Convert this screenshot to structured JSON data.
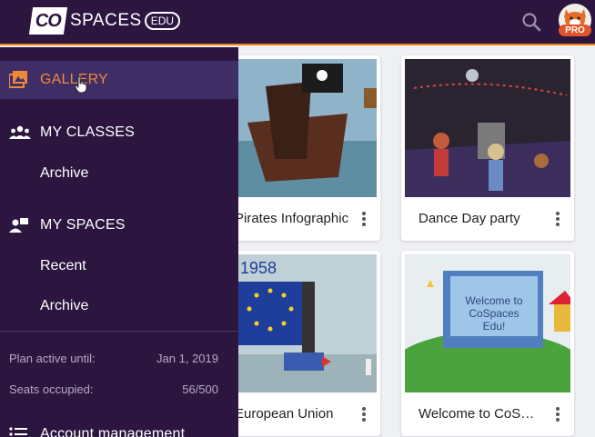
{
  "header": {
    "logo": {
      "co": "CO",
      "spaces": "SPACES",
      "edu": "EDU"
    },
    "search_icon": "search-icon",
    "avatar_badge": "PRO",
    "bar_color": "#2c1640",
    "accent_color": "#f07d1a"
  },
  "sidebar": {
    "gallery_label": "GALLERY",
    "my_classes_label": "MY CLASSES",
    "classes_archive": "Archive",
    "my_spaces_label": "MY SPACES",
    "spaces_recent": "Recent",
    "spaces_archive": "Archive",
    "plan_label": "Plan active until:",
    "plan_value": "Jan 1, 2019",
    "seats_label": "Seats occupied:",
    "seats_value": "56/500",
    "account_label": "Account management",
    "active_color": "#f0883a"
  },
  "gallery": {
    "cards": [
      {
        "title": "Pirates Infographic"
      },
      {
        "title": "Dance Day party"
      },
      {
        "title": "European Union"
      },
      {
        "title": "Welcome to CoSpaces Edu!"
      }
    ],
    "thumb_texts": {
      "year": "1958",
      "welcome_line1": "Welcome to",
      "welcome_line2": "CoSpaces",
      "welcome_line3": "Edu!"
    }
  }
}
